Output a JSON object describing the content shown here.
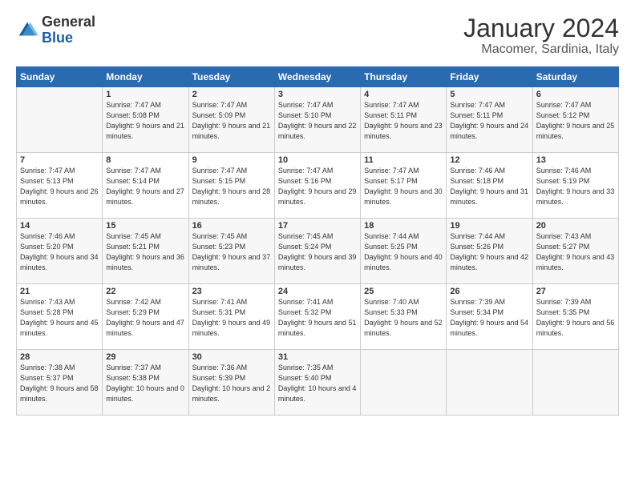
{
  "header": {
    "logo_general": "General",
    "logo_blue": "Blue",
    "month_title": "January 2024",
    "location": "Macomer, Sardinia, Italy"
  },
  "weekdays": [
    "Sunday",
    "Monday",
    "Tuesday",
    "Wednesday",
    "Thursday",
    "Friday",
    "Saturday"
  ],
  "weeks": [
    [
      {
        "day": "",
        "sunrise": "",
        "sunset": "",
        "daylight": ""
      },
      {
        "day": "1",
        "sunrise": "Sunrise: 7:47 AM",
        "sunset": "Sunset: 5:08 PM",
        "daylight": "Daylight: 9 hours and 21 minutes."
      },
      {
        "day": "2",
        "sunrise": "Sunrise: 7:47 AM",
        "sunset": "Sunset: 5:09 PM",
        "daylight": "Daylight: 9 hours and 21 minutes."
      },
      {
        "day": "3",
        "sunrise": "Sunrise: 7:47 AM",
        "sunset": "Sunset: 5:10 PM",
        "daylight": "Daylight: 9 hours and 22 minutes."
      },
      {
        "day": "4",
        "sunrise": "Sunrise: 7:47 AM",
        "sunset": "Sunset: 5:11 PM",
        "daylight": "Daylight: 9 hours and 23 minutes."
      },
      {
        "day": "5",
        "sunrise": "Sunrise: 7:47 AM",
        "sunset": "Sunset: 5:11 PM",
        "daylight": "Daylight: 9 hours and 24 minutes."
      },
      {
        "day": "6",
        "sunrise": "Sunrise: 7:47 AM",
        "sunset": "Sunset: 5:12 PM",
        "daylight": "Daylight: 9 hours and 25 minutes."
      }
    ],
    [
      {
        "day": "7",
        "sunrise": "Sunrise: 7:47 AM",
        "sunset": "Sunset: 5:13 PM",
        "daylight": "Daylight: 9 hours and 26 minutes."
      },
      {
        "day": "8",
        "sunrise": "Sunrise: 7:47 AM",
        "sunset": "Sunset: 5:14 PM",
        "daylight": "Daylight: 9 hours and 27 minutes."
      },
      {
        "day": "9",
        "sunrise": "Sunrise: 7:47 AM",
        "sunset": "Sunset: 5:15 PM",
        "daylight": "Daylight: 9 hours and 28 minutes."
      },
      {
        "day": "10",
        "sunrise": "Sunrise: 7:47 AM",
        "sunset": "Sunset: 5:16 PM",
        "daylight": "Daylight: 9 hours and 29 minutes."
      },
      {
        "day": "11",
        "sunrise": "Sunrise: 7:47 AM",
        "sunset": "Sunset: 5:17 PM",
        "daylight": "Daylight: 9 hours and 30 minutes."
      },
      {
        "day": "12",
        "sunrise": "Sunrise: 7:46 AM",
        "sunset": "Sunset: 5:18 PM",
        "daylight": "Daylight: 9 hours and 31 minutes."
      },
      {
        "day": "13",
        "sunrise": "Sunrise: 7:46 AM",
        "sunset": "Sunset: 5:19 PM",
        "daylight": "Daylight: 9 hours and 33 minutes."
      }
    ],
    [
      {
        "day": "14",
        "sunrise": "Sunrise: 7:46 AM",
        "sunset": "Sunset: 5:20 PM",
        "daylight": "Daylight: 9 hours and 34 minutes."
      },
      {
        "day": "15",
        "sunrise": "Sunrise: 7:45 AM",
        "sunset": "Sunset: 5:21 PM",
        "daylight": "Daylight: 9 hours and 36 minutes."
      },
      {
        "day": "16",
        "sunrise": "Sunrise: 7:45 AM",
        "sunset": "Sunset: 5:23 PM",
        "daylight": "Daylight: 9 hours and 37 minutes."
      },
      {
        "day": "17",
        "sunrise": "Sunrise: 7:45 AM",
        "sunset": "Sunset: 5:24 PM",
        "daylight": "Daylight: 9 hours and 39 minutes."
      },
      {
        "day": "18",
        "sunrise": "Sunrise: 7:44 AM",
        "sunset": "Sunset: 5:25 PM",
        "daylight": "Daylight: 9 hours and 40 minutes."
      },
      {
        "day": "19",
        "sunrise": "Sunrise: 7:44 AM",
        "sunset": "Sunset: 5:26 PM",
        "daylight": "Daylight: 9 hours and 42 minutes."
      },
      {
        "day": "20",
        "sunrise": "Sunrise: 7:43 AM",
        "sunset": "Sunset: 5:27 PM",
        "daylight": "Daylight: 9 hours and 43 minutes."
      }
    ],
    [
      {
        "day": "21",
        "sunrise": "Sunrise: 7:43 AM",
        "sunset": "Sunset: 5:28 PM",
        "daylight": "Daylight: 9 hours and 45 minutes."
      },
      {
        "day": "22",
        "sunrise": "Sunrise: 7:42 AM",
        "sunset": "Sunset: 5:29 PM",
        "daylight": "Daylight: 9 hours and 47 minutes."
      },
      {
        "day": "23",
        "sunrise": "Sunrise: 7:41 AM",
        "sunset": "Sunset: 5:31 PM",
        "daylight": "Daylight: 9 hours and 49 minutes."
      },
      {
        "day": "24",
        "sunrise": "Sunrise: 7:41 AM",
        "sunset": "Sunset: 5:32 PM",
        "daylight": "Daylight: 9 hours and 51 minutes."
      },
      {
        "day": "25",
        "sunrise": "Sunrise: 7:40 AM",
        "sunset": "Sunset: 5:33 PM",
        "daylight": "Daylight: 9 hours and 52 minutes."
      },
      {
        "day": "26",
        "sunrise": "Sunrise: 7:39 AM",
        "sunset": "Sunset: 5:34 PM",
        "daylight": "Daylight: 9 hours and 54 minutes."
      },
      {
        "day": "27",
        "sunrise": "Sunrise: 7:39 AM",
        "sunset": "Sunset: 5:35 PM",
        "daylight": "Daylight: 9 hours and 56 minutes."
      }
    ],
    [
      {
        "day": "28",
        "sunrise": "Sunrise: 7:38 AM",
        "sunset": "Sunset: 5:37 PM",
        "daylight": "Daylight: 9 hours and 58 minutes."
      },
      {
        "day": "29",
        "sunrise": "Sunrise: 7:37 AM",
        "sunset": "Sunset: 5:38 PM",
        "daylight": "Daylight: 10 hours and 0 minutes."
      },
      {
        "day": "30",
        "sunrise": "Sunrise: 7:36 AM",
        "sunset": "Sunset: 5:39 PM",
        "daylight": "Daylight: 10 hours and 2 minutes."
      },
      {
        "day": "31",
        "sunrise": "Sunrise: 7:35 AM",
        "sunset": "Sunset: 5:40 PM",
        "daylight": "Daylight: 10 hours and 4 minutes."
      },
      {
        "day": "",
        "sunrise": "",
        "sunset": "",
        "daylight": ""
      },
      {
        "day": "",
        "sunrise": "",
        "sunset": "",
        "daylight": ""
      },
      {
        "day": "",
        "sunrise": "",
        "sunset": "",
        "daylight": ""
      }
    ]
  ]
}
